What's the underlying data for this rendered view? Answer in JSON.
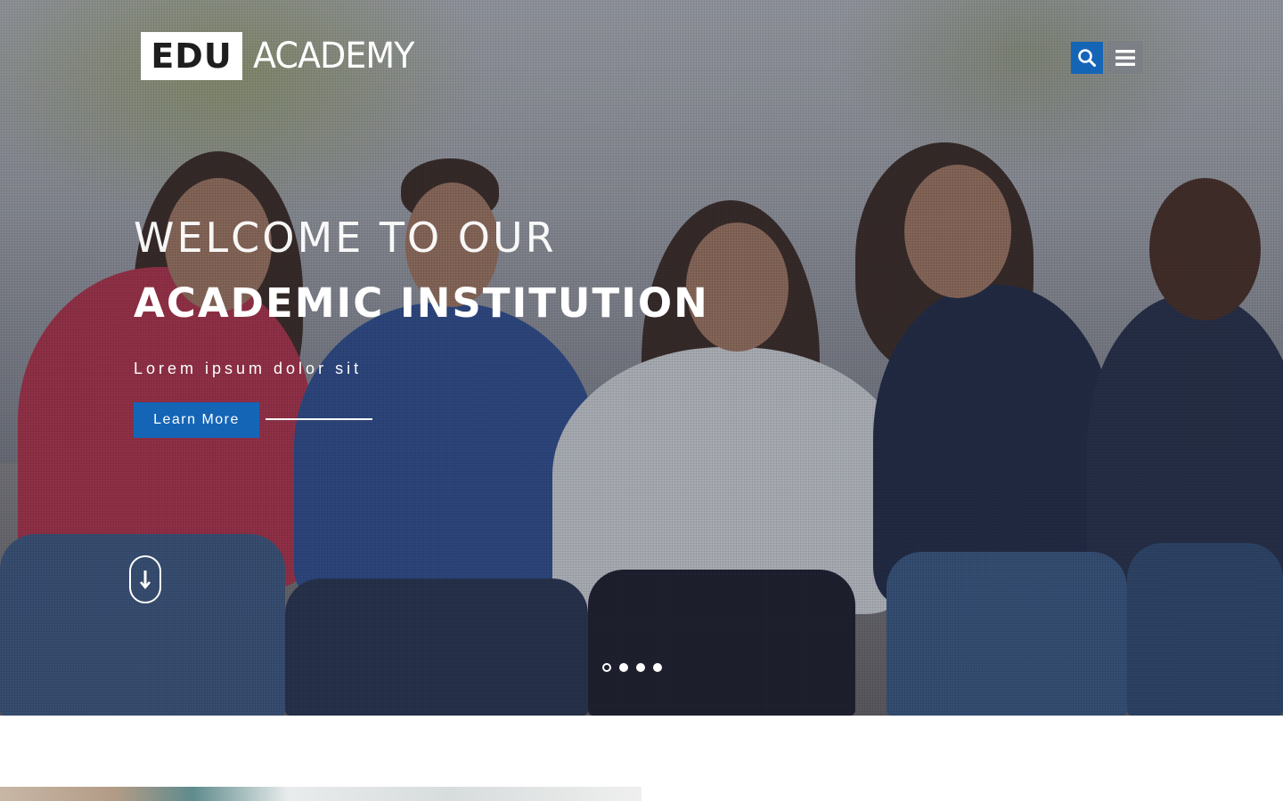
{
  "header": {
    "logo_bold": "EDU",
    "logo_light": "ACADEMY",
    "search_icon": "search-icon",
    "menu_icon": "hamburger-menu-icon"
  },
  "hero": {
    "welcome": "WELCOME TO OUR",
    "title": "ACADEMIC INSTITUTION",
    "subtitle": "Lorem ipsum dolor sit",
    "cta_label": "Learn More",
    "scroll_icon": "arrow-down-icon",
    "slides_total": 4,
    "slide_active": 1
  },
  "colors": {
    "accent": "#1565b7",
    "menu_button": "#7d7f86",
    "text_light": "#ffffff"
  }
}
